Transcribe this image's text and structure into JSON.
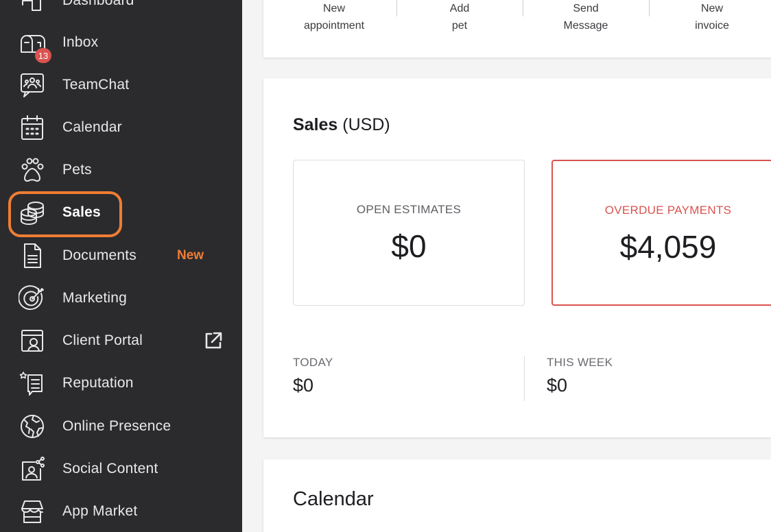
{
  "sidebar": {
    "items": [
      {
        "label": "Dashboard",
        "icon": "dashboard-icon"
      },
      {
        "label": "Inbox",
        "icon": "inbox-icon",
        "count": "13"
      },
      {
        "label": "TeamChat",
        "icon": "teamchat-icon"
      },
      {
        "label": "Calendar",
        "icon": "calendar-icon"
      },
      {
        "label": "Pets",
        "icon": "paw-icon"
      },
      {
        "label": "Sales",
        "icon": "coins-icon",
        "selected": true
      },
      {
        "label": "Documents",
        "icon": "document-icon",
        "tag": "New"
      },
      {
        "label": "Marketing",
        "icon": "target-icon"
      },
      {
        "label": "Client Portal",
        "icon": "client-portal-icon",
        "external": "external-link-icon"
      },
      {
        "label": "Reputation",
        "icon": "reputation-icon"
      },
      {
        "label": "Online Presence",
        "icon": "globe-icon"
      },
      {
        "label": "Social Content",
        "icon": "social-content-icon"
      },
      {
        "label": "App Market",
        "icon": "storefront-icon"
      }
    ]
  },
  "quick_actions": [
    {
      "line1": "New",
      "line2": "appointment"
    },
    {
      "line1": "Add",
      "line2": "pet"
    },
    {
      "line1": "Send",
      "line2": "Message"
    },
    {
      "line1": "New",
      "line2": "invoice"
    }
  ],
  "sales": {
    "title": "Sales",
    "currency": "(USD)",
    "open_estimates": {
      "label": "OPEN ESTIMATES",
      "value": "$0"
    },
    "overdue_payments": {
      "label": "OVERDUE PAYMENTS",
      "value": "$4,059"
    },
    "today": {
      "label": "TODAY",
      "value": "$0"
    },
    "this_week": {
      "label": "THIS WEEK",
      "value": "$0"
    }
  },
  "calendar": {
    "title": "Calendar"
  },
  "colors": {
    "sidebar_bg": "#2b2b2e",
    "accent_orange": "#f07d33",
    "danger_red": "#d9534f"
  }
}
